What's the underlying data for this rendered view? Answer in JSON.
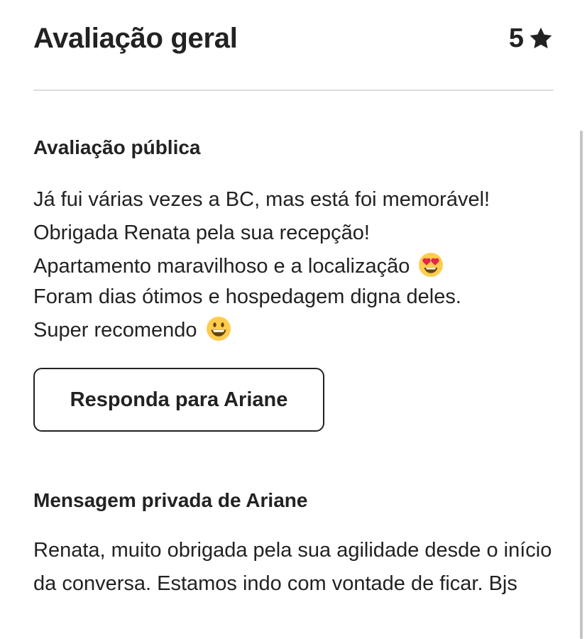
{
  "header": {
    "title": "Avaliação geral",
    "rating": "5",
    "rating_icon": "star-icon"
  },
  "public_review": {
    "title": "Avaliação pública",
    "lines": [
      "Já fui várias vezes a BC, mas está foi memorável!",
      "Obrigada Renata pela sua recepção!",
      "Apartamento maravilhoso e a localização",
      "Foram dias ótimos e hospedagem digna deles.",
      "Super recomendo"
    ],
    "line_emojis": [
      "",
      "",
      "heart-eyes-emoji-icon",
      "",
      "smiling-face-emoji-icon"
    ]
  },
  "reply_button": {
    "label": "Responda para Ariane"
  },
  "private_message": {
    "title": "Mensagem privada de Ariane",
    "text": "Renata, muito obrigada pela sua agilidade desde o início da conversa. Estamos indo com vontade de ficar. Bjs"
  },
  "colors": {
    "text": "#222222",
    "divider": "#dddddd",
    "scrollbar": "#c4c4c4",
    "emoji_face": "#FFCC4D"
  }
}
